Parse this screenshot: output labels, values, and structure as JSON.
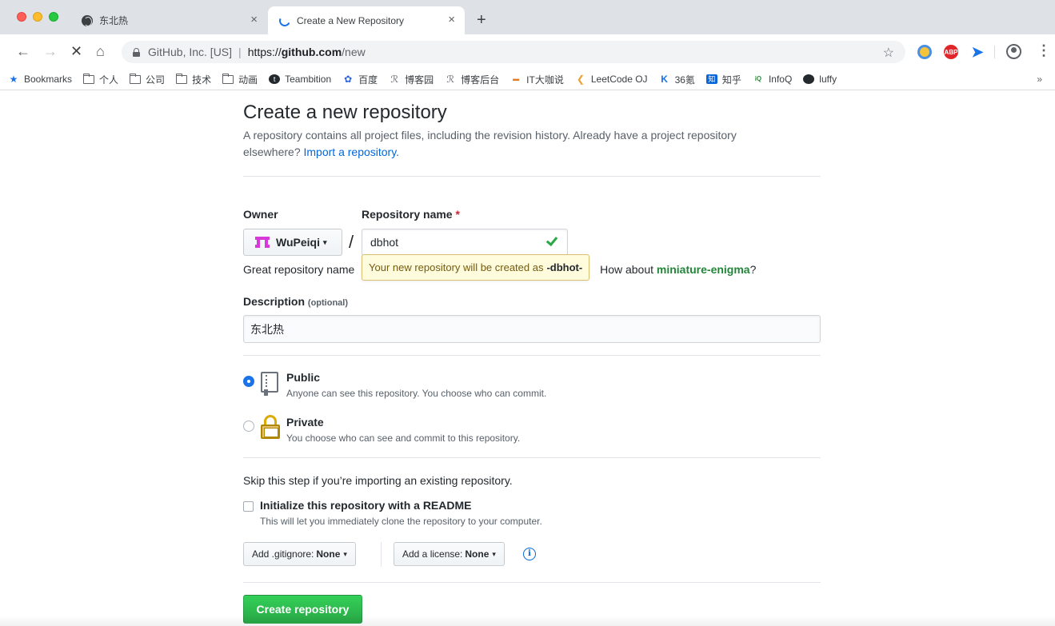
{
  "browser": {
    "tabs": [
      {
        "title": "东北热",
        "active": false
      },
      {
        "title": "Create a New Repository",
        "active": true
      }
    ],
    "close_glyph": "×",
    "new_tab_glyph": "+",
    "nav": {
      "back": "←",
      "forward": "→",
      "stop": "✕",
      "home": "⌂"
    },
    "omnibox": {
      "site_identity": "GitHub, Inc. [US]",
      "separator": "|",
      "url_scheme": "https://",
      "url_host": "github.com",
      "url_path": "/new"
    },
    "star_glyph": "☆",
    "menu_glyph": "⋮",
    "bookmarks": [
      {
        "label": "Bookmarks",
        "icon": "star-icon"
      },
      {
        "label": "个人",
        "icon": "folder-icon"
      },
      {
        "label": "公司",
        "icon": "folder-icon"
      },
      {
        "label": "技术",
        "icon": "folder-icon"
      },
      {
        "label": "动画",
        "icon": "folder-icon"
      },
      {
        "label": "Teambition",
        "icon": "teambition-icon"
      },
      {
        "label": "百度",
        "icon": "baidu-icon"
      },
      {
        "label": "博客园",
        "icon": "cnblogs-icon"
      },
      {
        "label": "博客后台",
        "icon": "cnblogs-icon"
      },
      {
        "label": "IT大咖说",
        "icon": "itdks-icon"
      },
      {
        "label": "LeetCode OJ",
        "icon": "leetcode-icon"
      },
      {
        "label": "36氪",
        "icon": "kr36-icon"
      },
      {
        "label": "知乎",
        "icon": "zhihu-icon"
      },
      {
        "label": "InfoQ",
        "icon": "infoq-icon"
      },
      {
        "label": "luffy",
        "icon": "github-icon"
      }
    ],
    "bookmarks_more": "»"
  },
  "page": {
    "heading": "Create a new repository",
    "description_text": "A repository contains all project files, including the revision history. Already have a project repository elsewhere?",
    "import_link": "Import a repository.",
    "owner_label": "Owner",
    "owner_name": "WuPeiqi",
    "repo_name_label": "Repository name",
    "required_mark": "*",
    "slash": "/",
    "repo_name_value": "dbhot",
    "suggestion_prefix": "Great repository name",
    "suggestion_mid": "How about",
    "suggestion_name": "miniature-enigma",
    "suggestion_end": "?",
    "tooltip_text": "Your new repository will be created as",
    "tooltip_name": "-dbhot-",
    "desc_label": "Description",
    "desc_optional": "(optional)",
    "desc_value": "东北热",
    "visibility": {
      "public_title": "Public",
      "public_note": "Anyone can see this repository. You choose who can commit.",
      "private_title": "Private",
      "private_note": "You choose who can see and commit to this repository.",
      "selected": "public"
    },
    "skip_note": "Skip this step if you’re importing an existing repository.",
    "init_title": "Initialize this repository with a README",
    "init_note": "This will let you immediately clone the repository to your computer.",
    "gitignore_label": "Add .gitignore:",
    "gitignore_value": "None",
    "license_label": "Add a license:",
    "license_value": "None",
    "caret": "▾",
    "info_glyph": "i",
    "create_button": "Create repository"
  },
  "colors": {
    "primary_button": "#28a745",
    "link": "#0366d6",
    "tooltip_bg": "#fffbdd"
  }
}
